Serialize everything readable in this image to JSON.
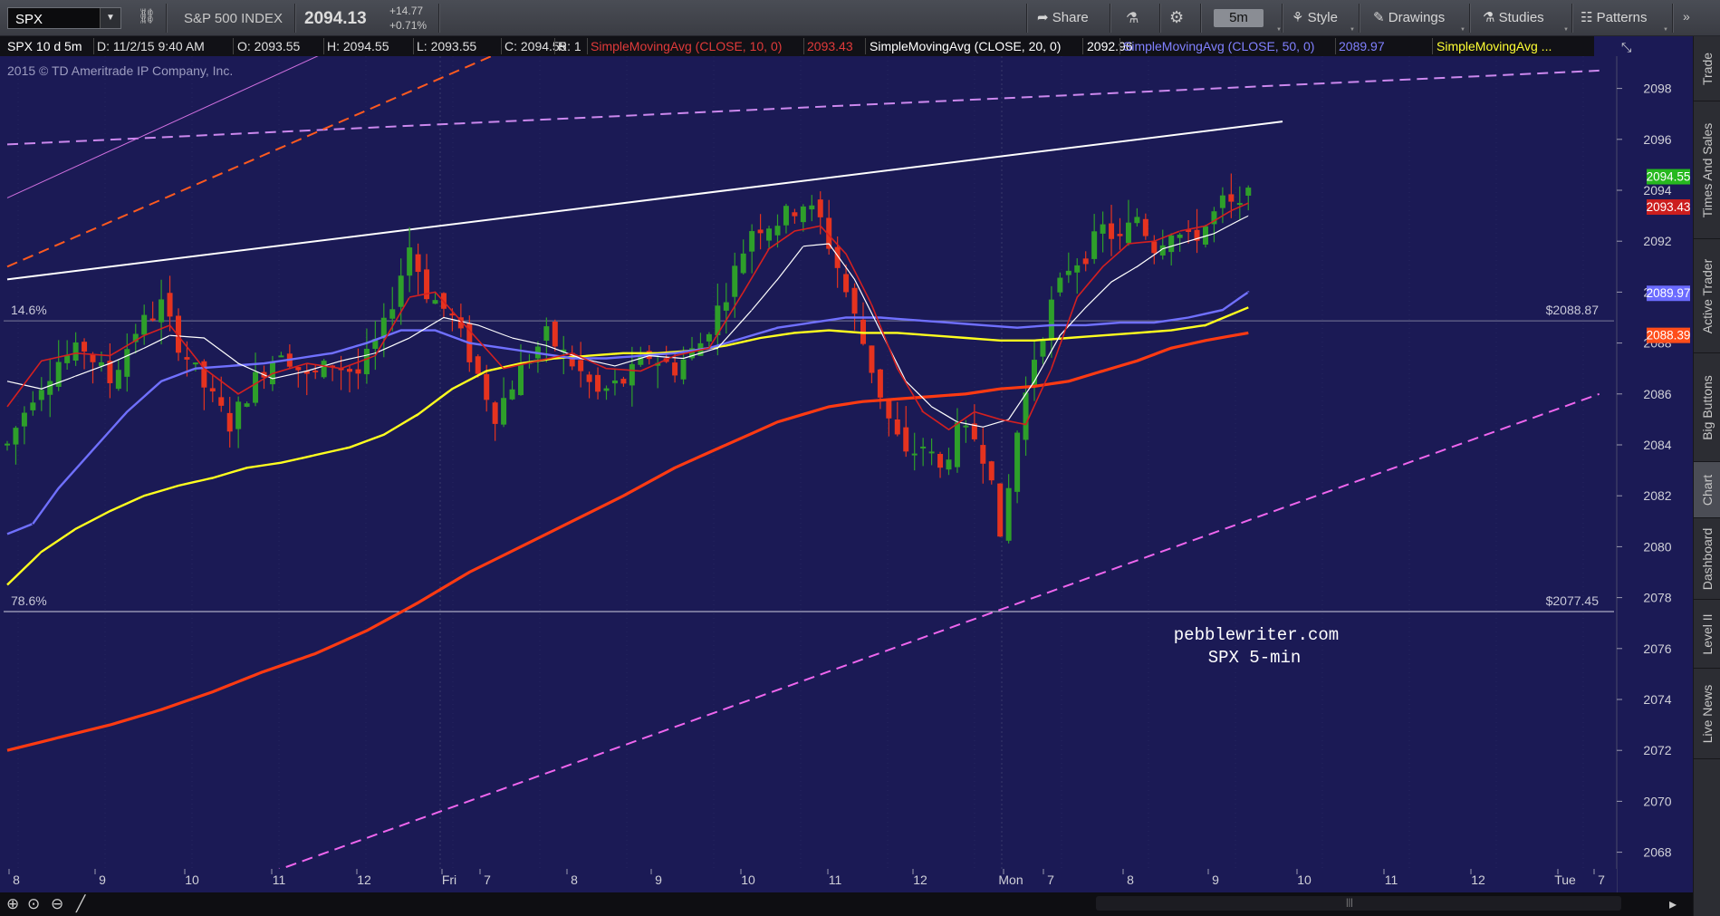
{
  "toolbar": {
    "symbol": "SPX",
    "index_name": "S&P 500 INDEX",
    "last_price": "2094.13",
    "change_abs": "+14.77",
    "change_pct": "+0.71%",
    "share_label": "Share",
    "style_label": "Style",
    "drawings_label": "Drawings",
    "studies_label": "Studies",
    "patterns_label": "Patterns",
    "timeframe": "5m"
  },
  "study_header": {
    "desc": "SPX 10 d 5m",
    "date": "D: 11/2/15 9:40 AM",
    "open": "O: 2093.55",
    "high": "H: 2094.55",
    "low": "L: 2093.55",
    "close": "C: 2094.55",
    "r": "R: 1",
    "sma10": "SimpleMovingAvg (CLOSE, 10, 0)",
    "sma10_val": "2093.43",
    "sma20": "SimpleMovingAvg (CLOSE, 20, 0)",
    "sma20_val": "2092.96",
    "sma50": "SimpleMovingAvg (CLOSE, 50, 0)",
    "sma50_val": "2089.97",
    "sma_more": "SimpleMovingAvg ..."
  },
  "copyright": "2015 © TD Ameritrade IP Company, Inc.",
  "watermark": {
    "line1": "pebblewriter.com",
    "line2": "SPX 5-min"
  },
  "fib_levels": [
    {
      "label": "14.6%",
      "price_label": "$2088.87",
      "value": 2088.87
    },
    {
      "label": "78.6%",
      "price_label": "$2077.45",
      "value": 2077.45
    }
  ],
  "price_badges": [
    {
      "text": "2094.55",
      "value": 2094.55,
      "color": "#27b81f"
    },
    {
      "text": "2093.43",
      "value": 2093.43,
      "color": "#cc1e1e"
    },
    {
      "text": "2089.97",
      "value": 2089.97,
      "color": "#6b6bff"
    },
    {
      "text": "2088.39",
      "value": 2088.39,
      "color": "#ff4d1a"
    }
  ],
  "x_axis_labels": [
    "8",
    "9",
    "10",
    "11",
    "12",
    "Fri",
    "7",
    "8",
    "9",
    "10",
    "11",
    "12",
    "Mon",
    "7",
    "8",
    "9",
    "10",
    "11",
    "12",
    "Tue",
    "7"
  ],
  "sidebar_tabs": [
    "Trade",
    "Times And Sales",
    "Active Trader",
    "Big Buttons",
    "Chart",
    "Dashboard",
    "Level II",
    "Live News"
  ],
  "sidebar_active": "Chart",
  "colors": {
    "chart_bg": "#1b1a55",
    "up": "#2e9f2a",
    "down": "#e5331f",
    "sma10": "#d42020",
    "sma20": "#ffffff",
    "sma50": "#7070ff",
    "sma100": "#ffff1f",
    "sma200": "#ff3a12"
  },
  "chart_data": {
    "type": "candlestick",
    "symbol": "SPX",
    "interval": "5m",
    "span": "10 d",
    "ylim": [
      2067,
      2100
    ],
    "y_ticks": [
      2068,
      2070,
      2072,
      2074,
      2076,
      2078,
      2080,
      2082,
      2084,
      2086,
      2088,
      2090,
      2092,
      2094,
      2096,
      2098
    ],
    "x_session_hours": [
      "8",
      "9",
      "10",
      "11",
      "12",
      "Fri 7",
      "8",
      "9",
      "10",
      "11",
      "12",
      "Mon 7",
      "8",
      "9",
      "10",
      "11",
      "12",
      "Tue 7"
    ],
    "price_path": [
      {
        "t": 0,
        "p": 2084.0
      },
      {
        "t": 3,
        "p": 2086.0
      },
      {
        "t": 6,
        "p": 2087.3
      },
      {
        "t": 9,
        "p": 2087.8
      },
      {
        "t": 12,
        "p": 2086.5
      },
      {
        "t": 15,
        "p": 2088.5
      },
      {
        "t": 18,
        "p": 2089.5
      },
      {
        "t": 20,
        "p": 2088.0
      },
      {
        "t": 23,
        "p": 2086.3
      },
      {
        "t": 26,
        "p": 2084.8
      },
      {
        "t": 29,
        "p": 2086.6
      },
      {
        "t": 32,
        "p": 2087.8
      },
      {
        "t": 35,
        "p": 2086.6
      },
      {
        "t": 38,
        "p": 2087.2
      },
      {
        "t": 41,
        "p": 2086.8
      },
      {
        "t": 44,
        "p": 2088.6
      },
      {
        "t": 47,
        "p": 2091.8
      },
      {
        "t": 49,
        "p": 2090.0
      },
      {
        "t": 52,
        "p": 2089.0
      },
      {
        "t": 54,
        "p": 2087.5
      },
      {
        "t": 57,
        "p": 2085.2
      },
      {
        "t": 60,
        "p": 2087.0
      },
      {
        "t": 63,
        "p": 2088.3
      },
      {
        "t": 66,
        "p": 2087.2
      },
      {
        "t": 69,
        "p": 2086.0
      },
      {
        "t": 72,
        "p": 2086.5
      },
      {
        "t": 75,
        "p": 2087.5
      },
      {
        "t": 78,
        "p": 2087.0
      },
      {
        "t": 81,
        "p": 2088.0
      },
      {
        "t": 84,
        "p": 2090.0
      },
      {
        "t": 87,
        "p": 2092.5
      },
      {
        "t": 90,
        "p": 2092.8
      },
      {
        "t": 93,
        "p": 2093.5
      },
      {
        "t": 95,
        "p": 2092.8
      },
      {
        "t": 97,
        "p": 2091.0
      },
      {
        "t": 99,
        "p": 2089.0
      },
      {
        "t": 101,
        "p": 2087.0
      },
      {
        "t": 103,
        "p": 2085.0
      },
      {
        "t": 105,
        "p": 2083.5
      },
      {
        "t": 107,
        "p": 2084.0
      },
      {
        "t": 109,
        "p": 2083.0
      },
      {
        "t": 111,
        "p": 2084.5
      },
      {
        "t": 113,
        "p": 2084.3
      },
      {
        "t": 115,
        "p": 2083.0
      },
      {
        "t": 116,
        "p": 2080.0
      },
      {
        "t": 118,
        "p": 2084.5
      },
      {
        "t": 120,
        "p": 2087.5
      },
      {
        "t": 122,
        "p": 2089.5
      },
      {
        "t": 124,
        "p": 2091.0
      },
      {
        "t": 126,
        "p": 2091.5
      },
      {
        "t": 128,
        "p": 2092.5
      },
      {
        "t": 130,
        "p": 2092.0
      },
      {
        "t": 132,
        "p": 2093.0
      },
      {
        "t": 134,
        "p": 2091.8
      },
      {
        "t": 136,
        "p": 2092.5
      },
      {
        "t": 138,
        "p": 2092.0
      },
      {
        "t": 140,
        "p": 2092.6
      },
      {
        "t": 142,
        "p": 2093.5
      },
      {
        "t": 144,
        "p": 2093.2
      },
      {
        "t": 145,
        "p": 2094.5
      }
    ],
    "series": [
      {
        "name": "SimpleMovingAvg (CLOSE, 10, 0)",
        "last": 2093.43
      },
      {
        "name": "SimpleMovingAvg (CLOSE, 20, 0)",
        "last": 2092.96
      },
      {
        "name": "SimpleMovingAvg (CLOSE, 50, 0)",
        "last": 2089.97
      },
      {
        "name": "SimpleMovingAvg ...",
        "last": 2088.39
      }
    ],
    "sma10": [
      [
        0,
        2085.5
      ],
      [
        4,
        2087.3
      ],
      [
        8,
        2087.6
      ],
      [
        12,
        2087.5
      ],
      [
        16,
        2088.3
      ],
      [
        19,
        2088.7
      ],
      [
        23,
        2087.0
      ],
      [
        27,
        2086.0
      ],
      [
        31,
        2086.8
      ],
      [
        35,
        2087.2
      ],
      [
        39,
        2087.0
      ],
      [
        43,
        2087.5
      ],
      [
        47,
        2089.8
      ],
      [
        50,
        2090.0
      ],
      [
        54,
        2088.5
      ],
      [
        58,
        2087.0
      ],
      [
        62,
        2087.3
      ],
      [
        66,
        2087.6
      ],
      [
        70,
        2087.0
      ],
      [
        74,
        2086.9
      ],
      [
        78,
        2087.5
      ],
      [
        82,
        2087.8
      ],
      [
        86,
        2090.0
      ],
      [
        89,
        2091.7
      ],
      [
        92,
        2092.4
      ],
      [
        95,
        2092.6
      ],
      [
        98,
        2091.5
      ],
      [
        101,
        2089.5
      ],
      [
        104,
        2087.0
      ],
      [
        107,
        2085.3
      ],
      [
        110,
        2084.6
      ],
      [
        113,
        2085.3
      ],
      [
        116,
        2085.0
      ],
      [
        119,
        2084.8
      ],
      [
        122,
        2087.0
      ],
      [
        125,
        2089.8
      ],
      [
        128,
        2091.0
      ],
      [
        131,
        2091.9
      ],
      [
        134,
        2092.0
      ],
      [
        137,
        2092.4
      ],
      [
        140,
        2092.6
      ],
      [
        143,
        2093.2
      ],
      [
        145,
        2093.5
      ]
    ],
    "sma20": [
      [
        0,
        2086.5
      ],
      [
        4,
        2086.2
      ],
      [
        8,
        2086.7
      ],
      [
        12,
        2087.2
      ],
      [
        16,
        2087.8
      ],
      [
        19,
        2088.3
      ],
      [
        23,
        2088.2
      ],
      [
        27,
        2087.2
      ],
      [
        31,
        2086.6
      ],
      [
        35,
        2086.9
      ],
      [
        39,
        2087.3
      ],
      [
        43,
        2087.6
      ],
      [
        47,
        2088.2
      ],
      [
        51,
        2089.0
      ],
      [
        55,
        2088.7
      ],
      [
        59,
        2088.2
      ],
      [
        63,
        2087.9
      ],
      [
        67,
        2087.4
      ],
      [
        71,
        2087.1
      ],
      [
        75,
        2087.5
      ],
      [
        79,
        2087.4
      ],
      [
        83,
        2087.8
      ],
      [
        87,
        2089.3
      ],
      [
        90,
        2090.5
      ],
      [
        93,
        2091.8
      ],
      [
        96,
        2091.9
      ],
      [
        99,
        2090.5
      ],
      [
        102,
        2088.5
      ],
      [
        105,
        2086.5
      ],
      [
        108,
        2085.5
      ],
      [
        111,
        2084.9
      ],
      [
        114,
        2084.7
      ],
      [
        117,
        2085.0
      ],
      [
        120,
        2086.5
      ],
      [
        123,
        2088.3
      ],
      [
        126,
        2089.4
      ],
      [
        129,
        2090.4
      ],
      [
        132,
        2091.0
      ],
      [
        135,
        2091.7
      ],
      [
        138,
        2092.0
      ],
      [
        141,
        2092.3
      ],
      [
        145,
        2093.0
      ]
    ],
    "sma50": [
      [
        0,
        2080.5
      ],
      [
        3,
        2080.9
      ],
      [
        6,
        2082.3
      ],
      [
        10,
        2083.8
      ],
      [
        14,
        2085.3
      ],
      [
        18,
        2086.5
      ],
      [
        22,
        2087.0
      ],
      [
        26,
        2087.1
      ],
      [
        30,
        2087.2
      ],
      [
        34,
        2087.4
      ],
      [
        38,
        2087.6
      ],
      [
        42,
        2088.0
      ],
      [
        46,
        2088.5
      ],
      [
        50,
        2088.5
      ],
      [
        54,
        2088.0
      ],
      [
        58,
        2087.8
      ],
      [
        62,
        2087.6
      ],
      [
        66,
        2087.4
      ],
      [
        70,
        2087.4
      ],
      [
        74,
        2087.5
      ],
      [
        78,
        2087.6
      ],
      [
        82,
        2087.8
      ],
      [
        86,
        2088.2
      ],
      [
        90,
        2088.6
      ],
      [
        94,
        2088.8
      ],
      [
        98,
        2089.0
      ],
      [
        102,
        2089.0
      ],
      [
        106,
        2088.9
      ],
      [
        110,
        2088.8
      ],
      [
        114,
        2088.7
      ],
      [
        118,
        2088.6
      ],
      [
        122,
        2088.7
      ],
      [
        126,
        2088.7
      ],
      [
        130,
        2088.8
      ],
      [
        134,
        2088.8
      ],
      [
        138,
        2089.0
      ],
      [
        142,
        2089.3
      ],
      [
        145,
        2090.0
      ]
    ],
    "sma100": [
      [
        0,
        2078.5
      ],
      [
        4,
        2079.8
      ],
      [
        8,
        2080.7
      ],
      [
        12,
        2081.4
      ],
      [
        16,
        2082.0
      ],
      [
        20,
        2082.4
      ],
      [
        24,
        2082.7
      ],
      [
        28,
        2083.1
      ],
      [
        32,
        2083.3
      ],
      [
        36,
        2083.6
      ],
      [
        40,
        2083.9
      ],
      [
        44,
        2084.4
      ],
      [
        48,
        2085.2
      ],
      [
        52,
        2086.2
      ],
      [
        56,
        2086.9
      ],
      [
        60,
        2087.2
      ],
      [
        64,
        2087.4
      ],
      [
        68,
        2087.5
      ],
      [
        72,
        2087.6
      ],
      [
        76,
        2087.6
      ],
      [
        80,
        2087.7
      ],
      [
        84,
        2087.9
      ],
      [
        88,
        2088.2
      ],
      [
        92,
        2088.4
      ],
      [
        96,
        2088.5
      ],
      [
        100,
        2088.4
      ],
      [
        104,
        2088.4
      ],
      [
        108,
        2088.3
      ],
      [
        112,
        2088.2
      ],
      [
        116,
        2088.1
      ],
      [
        120,
        2088.1
      ],
      [
        124,
        2088.2
      ],
      [
        128,
        2088.3
      ],
      [
        132,
        2088.4
      ],
      [
        136,
        2088.5
      ],
      [
        140,
        2088.7
      ],
      [
        145,
        2089.4
      ]
    ],
    "sma200": [
      [
        0,
        2072.0
      ],
      [
        6,
        2072.5
      ],
      [
        12,
        2073.0
      ],
      [
        18,
        2073.6
      ],
      [
        24,
        2074.3
      ],
      [
        30,
        2075.1
      ],
      [
        36,
        2075.8
      ],
      [
        42,
        2076.7
      ],
      [
        48,
        2077.8
      ],
      [
        54,
        2079.0
      ],
      [
        60,
        2080.0
      ],
      [
        66,
        2081.0
      ],
      [
        72,
        2082.0
      ],
      [
        78,
        2083.1
      ],
      [
        84,
        2084.0
      ],
      [
        90,
        2084.9
      ],
      [
        96,
        2085.5
      ],
      [
        100,
        2085.7
      ],
      [
        104,
        2085.8
      ],
      [
        108,
        2085.9
      ],
      [
        112,
        2086.0
      ],
      [
        116,
        2086.2
      ],
      [
        120,
        2086.3
      ],
      [
        124,
        2086.5
      ],
      [
        128,
        2086.9
      ],
      [
        132,
        2087.3
      ],
      [
        136,
        2087.8
      ],
      [
        140,
        2088.1
      ],
      [
        145,
        2088.4
      ]
    ],
    "trendlines": [
      {
        "name": "white-resistance",
        "color": "#ffffff",
        "dash": false,
        "from": [
          0,
          2090.5
        ],
        "to": [
          149,
          2096.7
        ]
      },
      {
        "name": "violet-upper",
        "color": "#cc88ee",
        "dash": true,
        "from": [
          0,
          2095.8
        ],
        "to": [
          186,
          2098.7
        ]
      },
      {
        "name": "violet-lower",
        "color": "#ee66ee",
        "dash": true,
        "from": [
          25,
          2066.5
        ],
        "to": [
          186,
          2086.0
        ]
      },
      {
        "name": "orange-dashed",
        "color": "#ff5a1f",
        "dash": true,
        "from": [
          0,
          2091.0
        ],
        "to": [
          65,
          2100.5
        ]
      },
      {
        "name": "thin-violet",
        "color": "#d070e0",
        "dash": false,
        "from": [
          0,
          2093.7
        ],
        "to": [
          41,
          2100.0
        ]
      }
    ]
  }
}
